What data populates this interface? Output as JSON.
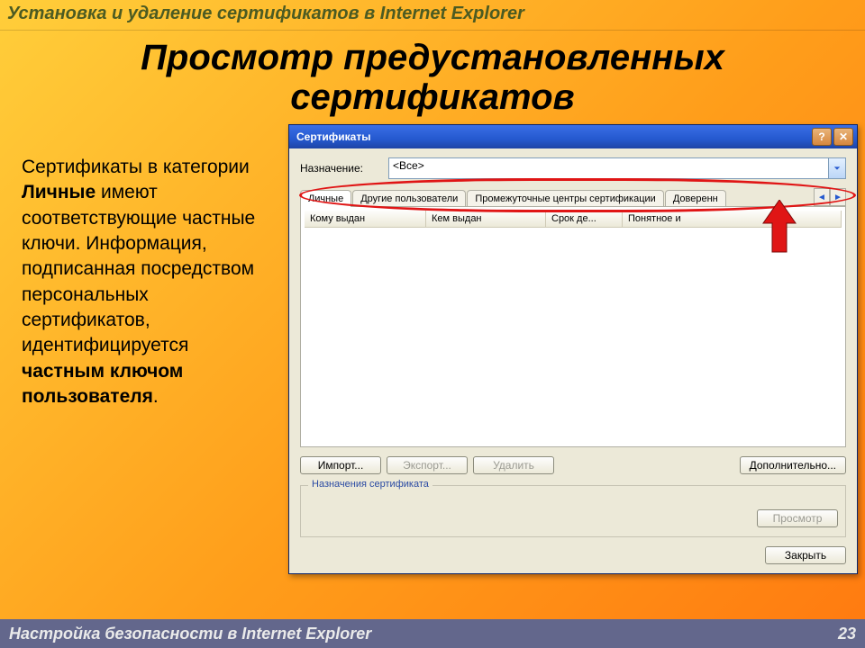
{
  "slide": {
    "header": "Установка и удаление сертификатов в Internet Explorer",
    "title": "Просмотр предустановленных сертификатов",
    "body_html": "Сертификаты в категории <b>Личные</b> имеют соответствующие частные ключи. Информация, подписанная посредством персональных сертификатов, идентифицируется <b>частным ключом пользователя</b>.",
    "footer": "Настройка безопасности в Internet Explorer",
    "page_number": "23"
  },
  "dialog": {
    "title": "Сертификаты",
    "purpose_label": "Назначение:",
    "purpose_value": "<Все>",
    "tabs": [
      "Личные",
      "Другие пользователи",
      "Промежуточные центры сертификации",
      "Доверенн"
    ],
    "active_tab_index": 0,
    "columns": [
      "Кому выдан",
      "Кем выдан",
      "Срок де...",
      "Понятное и"
    ],
    "buttons": {
      "import": "Импорт...",
      "export": "Экспорт...",
      "delete": "Удалить",
      "advanced": "Дополнительно...",
      "view": "Просмотр",
      "close": "Закрыть"
    },
    "groupbox_title": "Назначения сертификата",
    "titlebar_help": "?",
    "titlebar_close": "✕"
  },
  "icons": {
    "chevron_down": "chevron-down-icon",
    "chevron_left": "chevron-left-icon",
    "chevron_right": "chevron-right-icon"
  }
}
